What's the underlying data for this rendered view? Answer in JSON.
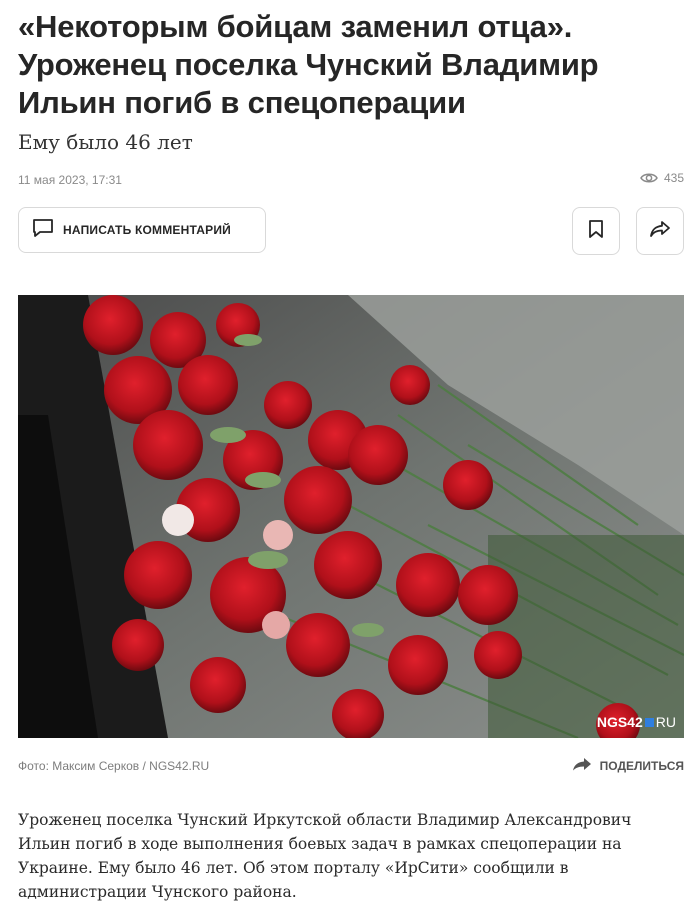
{
  "article": {
    "title": "«Некоторым бойцам заменил отца». Уроженец поселка Чунский Владимир Ильин погиб в спецоперации",
    "subtitle": "Ему было 46 лет",
    "date": "11 мая 2023, 17:31",
    "views": "435",
    "body": "Уроженец поселка Чунский Иркутской области Владимир Александрович Ильин погиб в ходе выполнения боевых задач в рамках спецоперации на Украине. Ему было 46 лет. Об этом порталу «ИрСити» сообщили в администрации Чунского района."
  },
  "actions": {
    "comment_label": "НАПИСАТЬ КОММЕНТАРИЙ",
    "share_label": "ПОДЕЛИТЬСЯ"
  },
  "photo": {
    "caption": "Фото: Максим Серков / NGS42.RU",
    "watermark_brand": "NGS42",
    "watermark_tld": "RU"
  },
  "icons": {
    "comment": "comment-icon",
    "bookmark": "bookmark-icon",
    "share": "share-icon",
    "views": "eye-icon"
  },
  "colors": {
    "text": "#262626",
    "muted": "#8a8a8a",
    "border": "#d9d9d9",
    "carnation": "#c1121f"
  }
}
